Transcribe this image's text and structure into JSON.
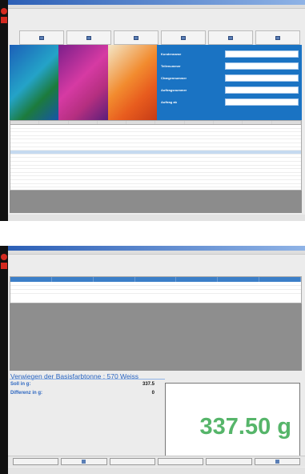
{
  "screen1": {
    "window_title": "",
    "menu": [],
    "toolbar": [],
    "form": {
      "fields": [
        {
          "label": "Kundenname",
          "value": ""
        },
        {
          "label": "Teilenummer",
          "value": ""
        },
        {
          "label": "Chargennummer",
          "value": ""
        },
        {
          "label": "Auftragsnummer",
          "value": ""
        },
        {
          "label": "Auftrag ab",
          "value": ""
        }
      ]
    },
    "grid": {
      "columns": [],
      "rows": []
    },
    "statusbar": ""
  },
  "screen2": {
    "window_title": "",
    "list": {
      "columns": [],
      "rows": []
    },
    "weighing": {
      "title": "Verwiegen der Basisfarbtonne : 570 Weiss",
      "soll_label": "Soll in g:",
      "soll_value": "337.5",
      "diff_label": "Differenz in g:",
      "diff_value": "0",
      "display": "337.50 g"
    },
    "bottom_buttons": [],
    "statusbar": ""
  },
  "colors": {
    "accent_blue": "#1a73c3",
    "weight_green": "#56b56a",
    "brand_red": "#d42a20"
  }
}
